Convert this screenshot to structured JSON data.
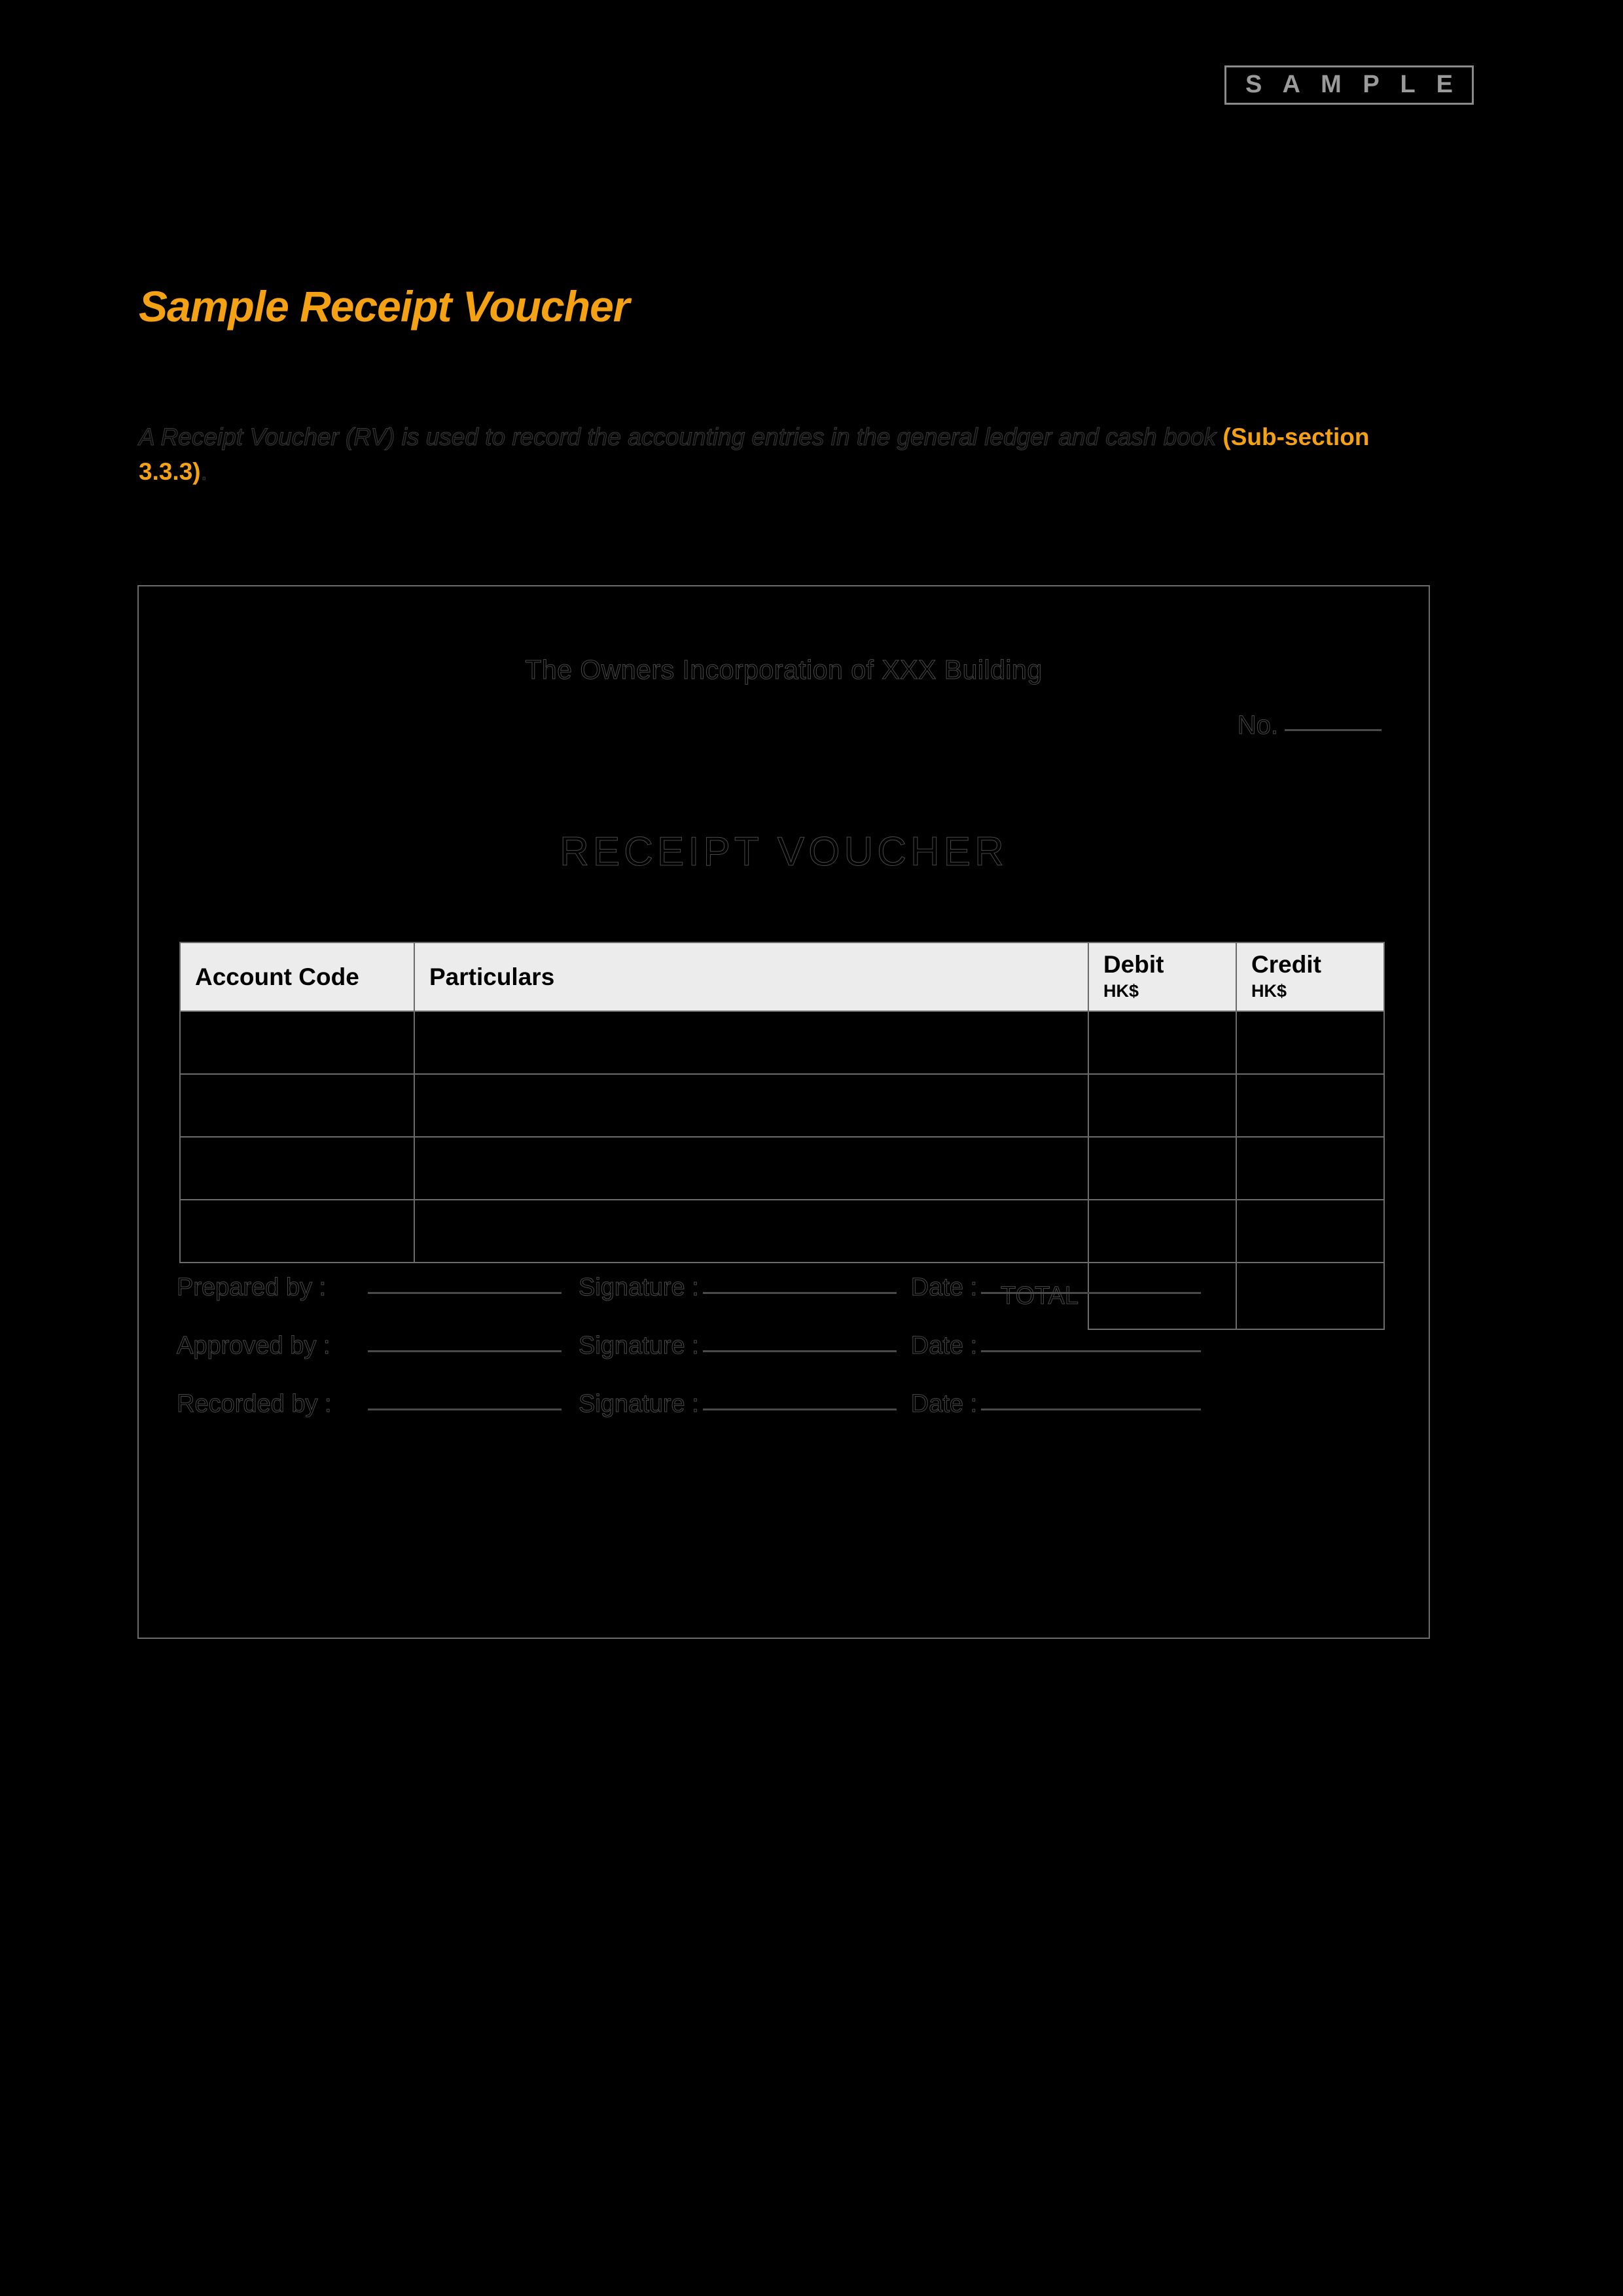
{
  "badge": {
    "label": "S A M P L E"
  },
  "page": {
    "title": "Sample Receipt Voucher",
    "intro_part1": "A Receipt Voucher (RV) is used to record the accounting entries in the general ledger and cash book ",
    "intro_reference": "(Sub-section 3.3.3)",
    "intro_part2": "."
  },
  "voucher": {
    "organisation": "The Owners Incorporation of XXX Building",
    "number_label": "No.",
    "heading": "RECEIPT VOUCHER",
    "table": {
      "headers": {
        "account_code": "Account Code",
        "particulars": "Particulars",
        "debit": "Debit",
        "debit_currency": "HK$",
        "credit": "Credit",
        "credit_currency": "HK$"
      },
      "rows": [
        {
          "account_code": "",
          "particulars": "",
          "debit": "",
          "credit": ""
        },
        {
          "account_code": "",
          "particulars": "",
          "debit": "",
          "credit": ""
        },
        {
          "account_code": "",
          "particulars": "",
          "debit": "",
          "credit": ""
        },
        {
          "account_code": "",
          "particulars": "",
          "debit": "",
          "credit": ""
        }
      ],
      "total_label": "TOTAL",
      "total_debit": "",
      "total_credit": ""
    },
    "signatures": {
      "signature_label": "Signature :",
      "date_label": "Date :",
      "rows": [
        {
          "role": "Prepared by  :"
        },
        {
          "role": "Approved by :"
        },
        {
          "role": "Recorded by :"
        }
      ]
    }
  },
  "colors": {
    "background": "#000000",
    "accent_orange": "#f5a114",
    "badge_gray": "#9a9a9a",
    "table_header_bg": "#ececec",
    "rule_gray": "#6b6b6b"
  }
}
